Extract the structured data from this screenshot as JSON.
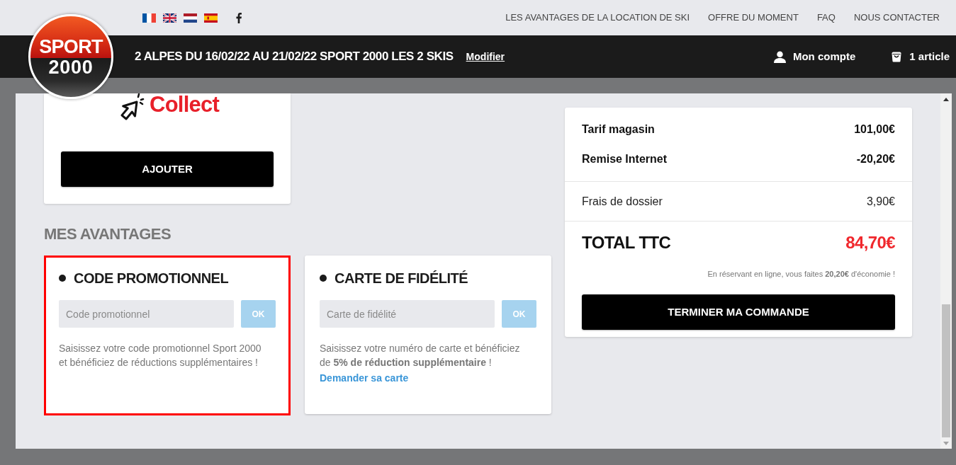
{
  "top_bar": {
    "nav_links": [
      "LES AVANTAGES DE LA LOCATION DE SKI",
      "OFFRE DU MOMENT",
      "FAQ",
      "NOUS CONTACTER"
    ]
  },
  "header": {
    "logo": {
      "line_1": "SPORT",
      "line_2": "2000"
    },
    "booking_summary": "2 ALPES DU 16/02/22 AU 21/02/22 SPORT 2000 LES 2 SKIS",
    "edit_link": "Modifier",
    "account": "Mon compte",
    "cart": "1 article"
  },
  "service_card": {
    "logo_text": "Collect",
    "button": "AJOUTER"
  },
  "advantages": {
    "title": "MES AVANTAGES",
    "cards": [
      {
        "title": "CODE PROMOTIONNEL",
        "placeholder": "Code promotionnel",
        "button": "OK",
        "disabled": true,
        "description": "Saisissez votre code promotionnel Sport 2000 et bénéficiez de réductions supplémentaires !",
        "highlighted": true
      },
      {
        "title": "CARTE DE FIDÉLITÉ",
        "placeholder": "Carte de fidélité",
        "button": "OK",
        "disabled": true,
        "description": "Saisissez votre numéro de carte et bénéficiez de **5% de réduction supplémentaire** !",
        "link": "Demander sa carte",
        "highlighted": false
      }
    ]
  },
  "summary": {
    "sections": [
      {
        "rows": [
          {
            "kind": "bold",
            "label": "Tarif magasin",
            "value": "101,00€"
          },
          {
            "kind": "bold",
            "label": "Remise Internet",
            "value": "-20,20€"
          }
        ]
      },
      {
        "rows": [
          {
            "kind": "plain",
            "label": "Frais de dossier",
            "value": "3,90€"
          }
        ]
      }
    ],
    "total": {
      "label": "TOTAL TTC",
      "value": "84,70€"
    },
    "savings_note": "En réservant en ligne, vous faites **20,20€** d'économie !",
    "button": "TERMINER MA COMMANDE"
  }
}
